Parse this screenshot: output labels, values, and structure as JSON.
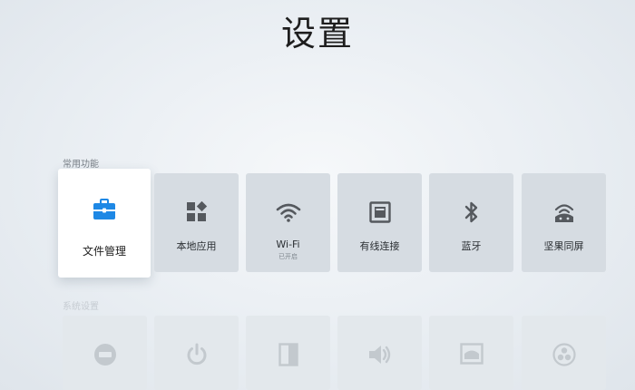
{
  "page": {
    "title": "设置"
  },
  "sections": {
    "common": {
      "label": "常用功能",
      "items": [
        {
          "label": "文件管理",
          "sub": "",
          "icon": "toolbox-icon"
        },
        {
          "label": "本地应用",
          "sub": "",
          "icon": "apps-grid-icon"
        },
        {
          "label": "Wi-Fi",
          "sub": "已开启",
          "icon": "wifi-icon"
        },
        {
          "label": "有线连接",
          "sub": "",
          "icon": "ethernet-port-icon"
        },
        {
          "label": "蓝牙",
          "sub": "",
          "icon": "bluetooth-icon"
        },
        {
          "label": "坚果同屏",
          "sub": "",
          "icon": "screen-cast-icon"
        }
      ]
    },
    "system": {
      "label": "系统设置",
      "items": [
        {
          "icon": "hdmi-icon"
        },
        {
          "icon": "power-icon"
        },
        {
          "icon": "display-panel-icon"
        },
        {
          "icon": "volume-icon"
        },
        {
          "icon": "picture-mode-icon"
        },
        {
          "icon": "fan-icon"
        }
      ]
    }
  },
  "colors": {
    "accent": "#1e88e5",
    "icon": "#55595e",
    "icon_dim": "#c3c9ce"
  }
}
